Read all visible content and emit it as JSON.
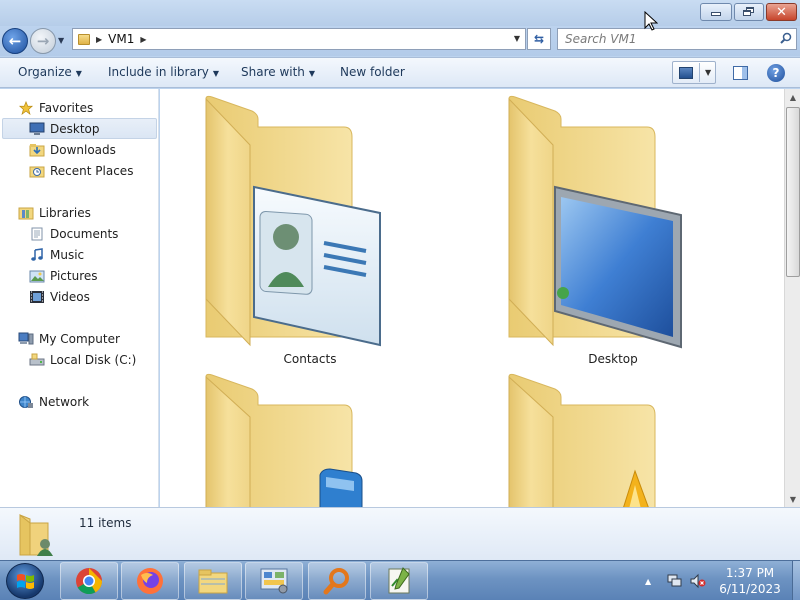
{
  "window": {
    "address_segment": "VM1",
    "search_placeholder": "Search VM1",
    "close_glyph": "✕"
  },
  "navigation": {
    "back_glyph": "←",
    "forward_glyph": "→"
  },
  "toolbar": {
    "organize": "Organize",
    "include_in_library": "Include in library",
    "share_with": "Share with",
    "new_folder": "New folder",
    "help_glyph": "?"
  },
  "nav_pane": {
    "favorites": {
      "label": "Favorites",
      "items": [
        {
          "label": "Desktop",
          "icon": "desktop-icon",
          "selected": true
        },
        {
          "label": "Downloads",
          "icon": "downloads-folder-icon"
        },
        {
          "label": "Recent Places",
          "icon": "recent-places-icon"
        }
      ]
    },
    "libraries": {
      "label": "Libraries",
      "items": [
        {
          "label": "Documents",
          "icon": "documents-icon"
        },
        {
          "label": "Music",
          "icon": "music-icon"
        },
        {
          "label": "Pictures",
          "icon": "pictures-icon"
        },
        {
          "label": "Videos",
          "icon": "videos-icon"
        }
      ]
    },
    "computer": {
      "label": "My Computer",
      "items": [
        {
          "label": "Local Disk (C:)",
          "icon": "local-disk-icon"
        }
      ]
    },
    "network": {
      "label": "Network"
    }
  },
  "folders": [
    {
      "label": "Contacts",
      "icon": "contacts-folder-icon"
    },
    {
      "label": "Desktop",
      "icon": "desktop-folder-icon"
    },
    {
      "label": "",
      "icon": "folder-icon"
    },
    {
      "label": "",
      "icon": "folder-icon"
    }
  ],
  "details": {
    "item_count": "11 items"
  },
  "taskbar": {
    "apps": [
      "chrome-icon",
      "firefox-icon",
      "file-explorer-icon",
      "control-panel-icon",
      "search-tool-icon",
      "notepad-icon"
    ],
    "time": "1:37 PM",
    "date": "6/11/2023"
  },
  "colors": {
    "chrome": "#bcd3ee",
    "folder_yellow": "#f2d77f",
    "accent_blue": "#1d4f9e",
    "close_red": "#c7452c"
  }
}
